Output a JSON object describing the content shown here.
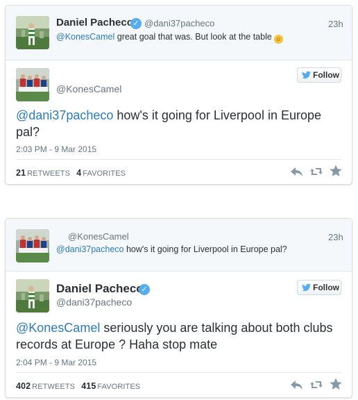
{
  "tweet1": {
    "parent": {
      "name": "Daniel Pacheco",
      "handle": "@dani37pacheco",
      "time": "23h",
      "mention": "@KonesCamel",
      "text": " great goal that was. But look at the table"
    },
    "main": {
      "handle": "@KonesCamel",
      "follow_label": "Follow",
      "mention": "@dani37pacheco",
      "text": " how's it going for Liverpool in Europe pal?",
      "timestamp": "2:03 PM - 9 Mar 2015",
      "retweets_count": "21",
      "retweets_label": "RETWEETS",
      "favorites_count": "4",
      "favorites_label": "FAVORITES"
    }
  },
  "tweet2": {
    "parent": {
      "handle": "@KonesCamel",
      "time": "23h",
      "mention": "@dani37pacheco",
      "text": " how's it going for Liverpool in Europe pal?"
    },
    "main": {
      "name": "Daniel Pacheco",
      "handle": "@dani37pacheco",
      "follow_label": "Follow",
      "mention": "@KonesCamel",
      "text_line1": " seriously you are talking about both clubs",
      "text_line2": "records at Europe ? Haha stop mate",
      "timestamp": "2:04 PM - 9 Mar 2015",
      "retweets_count": "402",
      "retweets_label": "RETWEETS",
      "favorites_count": "415",
      "favorites_label": "FAVORITES"
    }
  },
  "icons": {
    "verified": "verified-badge-icon",
    "bird": "twitter-bird-icon",
    "reply": "reply-icon",
    "retweet": "retweet-icon",
    "favorite": "star-icon",
    "emoji": "smiling-face-emoji"
  },
  "colors": {
    "link": "#2b7bb9",
    "verified": "#55acee",
    "bird": "#55acee",
    "muted": "#66757f",
    "action": "#8899a6"
  }
}
